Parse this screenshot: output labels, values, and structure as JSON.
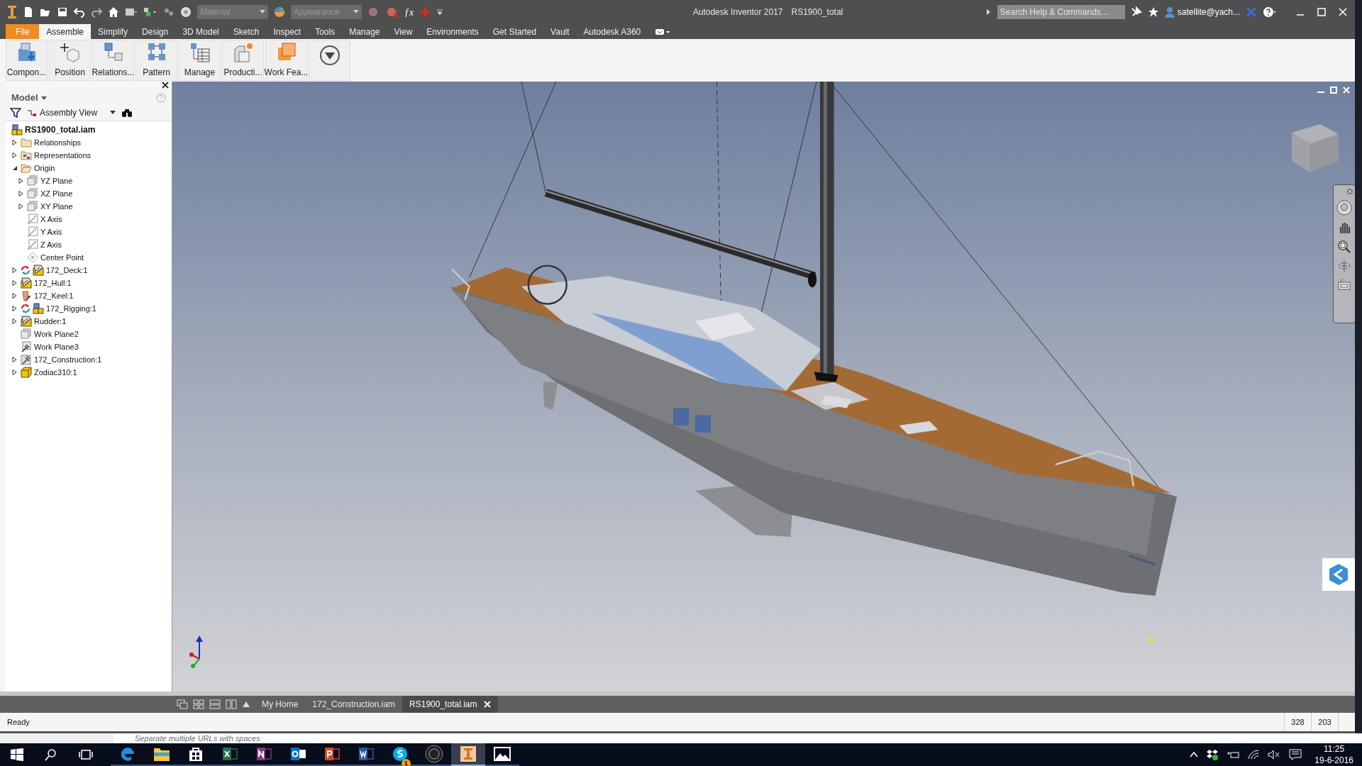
{
  "title_bar": {
    "app": "Autodesk Inventor 2017",
    "document": "RS1900_total",
    "material_placeholder": "Material",
    "appearance_placeholder": "Appearance",
    "formula_label": "ƒx",
    "search_placeholder": "Search Help & Commands...",
    "user": "satellite@yach..."
  },
  "ribbon_tabs": [
    {
      "label": "File",
      "kind": "file",
      "selected": false
    },
    {
      "label": "Assemble",
      "kind": "tab",
      "selected": true
    },
    {
      "label": "Simplify",
      "kind": "tab",
      "selected": false
    },
    {
      "label": "Design",
      "kind": "tab",
      "selected": false
    },
    {
      "label": "3D Model",
      "kind": "tab",
      "selected": false
    },
    {
      "label": "Sketch",
      "kind": "tab",
      "selected": false
    },
    {
      "label": "Inspect",
      "kind": "tab",
      "selected": false
    },
    {
      "label": "Tools",
      "kind": "tab",
      "selected": false
    },
    {
      "label": "Manage",
      "kind": "tab",
      "selected": false
    },
    {
      "label": "View",
      "kind": "tab",
      "selected": false
    },
    {
      "label": "Environments",
      "kind": "tab",
      "selected": false
    },
    {
      "label": "Get Started",
      "kind": "tab",
      "selected": false
    },
    {
      "label": "Vault",
      "kind": "tab",
      "selected": false
    },
    {
      "label": "Autodesk A360",
      "kind": "tab",
      "selected": false
    }
  ],
  "ribbon_buttons": [
    {
      "label": "Compon...",
      "kind": "component"
    },
    {
      "label": "Position",
      "kind": "position"
    },
    {
      "label": "Relations...",
      "kind": "relationships"
    },
    {
      "label": "Pattern",
      "kind": "pattern"
    },
    {
      "label": "Manage",
      "kind": "manage"
    },
    {
      "label": "Producti...",
      "kind": "productivity"
    },
    {
      "label": "Work Fea...",
      "kind": "work_features"
    },
    {
      "kind": "more"
    }
  ],
  "browser": {
    "title": "Model",
    "view": "Assembly View",
    "tree": [
      {
        "label": "RS1900_total.iam",
        "kind": "assembly",
        "refresh": false,
        "children": [
          {
            "label": "Relationships",
            "kind": "folder",
            "refresh": false,
            "expanded": false
          },
          {
            "label": "Representations",
            "kind": "representations",
            "refresh": false,
            "expanded": false
          },
          {
            "label": "Origin",
            "kind": "open_folder",
            "refresh": false,
            "expanded": true,
            "children": [
              {
                "label": "YZ Plane",
                "kind": "plane",
                "refresh": false,
                "expanded": false
              },
              {
                "label": "XZ Plane",
                "kind": "plane",
                "refresh": false,
                "expanded": false
              },
              {
                "label": "XY Plane",
                "kind": "plane",
                "refresh": false,
                "expanded": false
              },
              {
                "label": "X Axis",
                "kind": "axis",
                "refresh": false
              },
              {
                "label": "Y Axis",
                "kind": "axis",
                "refresh": false
              },
              {
                "label": "Z Axis",
                "kind": "axis",
                "refresh": false
              },
              {
                "label": "Center Point",
                "kind": "point",
                "refresh": false
              }
            ]
          },
          {
            "label": "172_Deck:1",
            "kind": "derived_part",
            "refresh": true,
            "expanded": false
          },
          {
            "label": "172_Hull:1",
            "kind": "derived_part",
            "refresh": false,
            "expanded": false
          },
          {
            "label": "172_Keel:1",
            "kind": "keel_part",
            "refresh": false,
            "expanded": false
          },
          {
            "label": "172_Rigging:1",
            "kind": "assembly",
            "refresh": true,
            "expanded": false
          },
          {
            "label": "Rudder:1",
            "kind": "derived_part",
            "refresh": false,
            "expanded": false
          },
          {
            "label": "Work Plane2",
            "kind": "plane",
            "refresh": false
          },
          {
            "label": "Work Plane3",
            "kind": "pinned_plane",
            "refresh": false
          },
          {
            "label": "172_Construction:1",
            "kind": "construction",
            "refresh": false,
            "expanded": false
          },
          {
            "label": "Zodiac310:1",
            "kind": "part",
            "refresh": false,
            "expanded": false
          }
        ]
      }
    ]
  },
  "document_tabs": [
    {
      "label": "My Home",
      "selected": false
    },
    {
      "label": "172_Construction.iam",
      "selected": false
    },
    {
      "label": "RS1900_total.iam",
      "selected": true
    }
  ],
  "status_bar": {
    "message": "Ready",
    "field_1": "328",
    "field_2": "203"
  },
  "background_text": "Separate multiple URLs with spaces",
  "taskbar": {
    "apps": [
      {
        "kind": "edge",
        "selected": false
      },
      {
        "kind": "explorer",
        "selected": false
      },
      {
        "kind": "store",
        "selected": false
      },
      {
        "kind": "excel",
        "selected": false
      },
      {
        "kind": "onenote",
        "selected": false
      },
      {
        "kind": "outlook",
        "selected": false
      },
      {
        "kind": "powerpoint",
        "selected": false
      },
      {
        "kind": "word",
        "selected": false
      },
      {
        "kind": "skype",
        "selected": false,
        "badge": "1"
      },
      {
        "kind": "sonos",
        "selected": false
      },
      {
        "kind": "inventor",
        "selected": true
      },
      {
        "kind": "photos",
        "selected": false
      }
    ],
    "time": "11:25",
    "date": "19-6-2016"
  }
}
